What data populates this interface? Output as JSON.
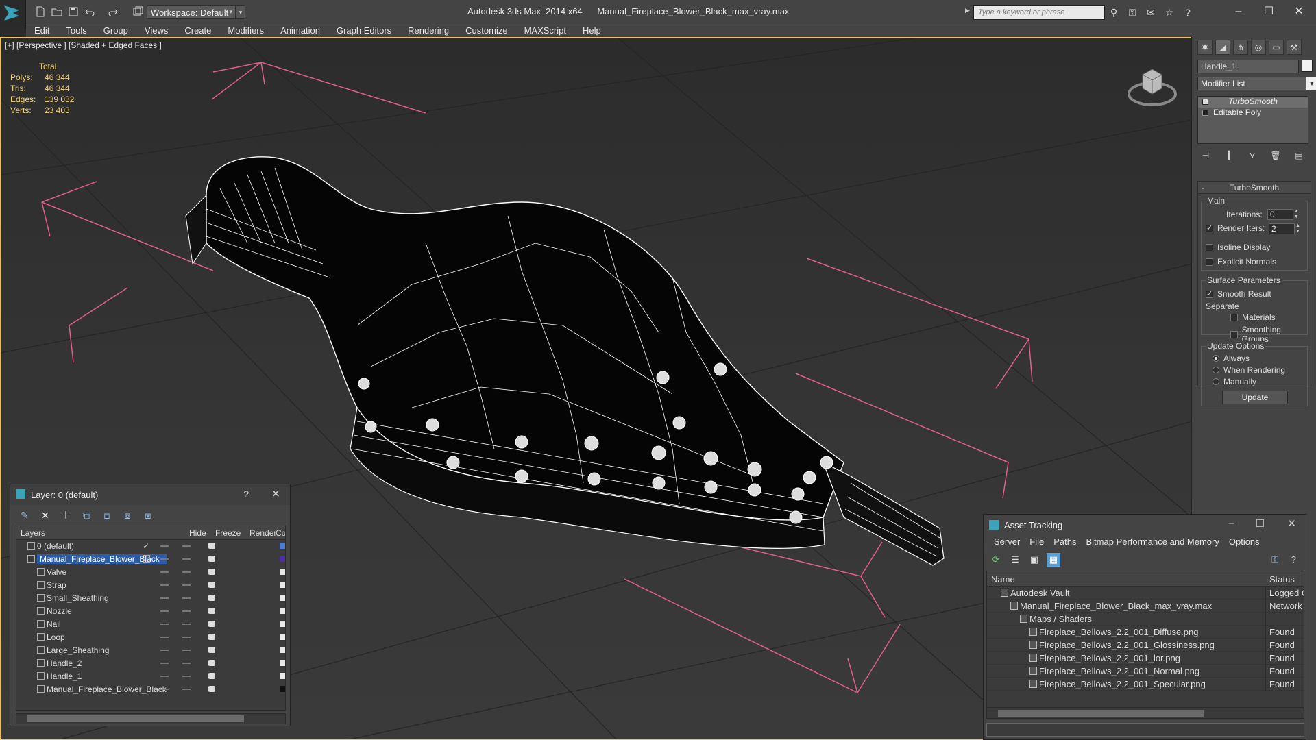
{
  "app": {
    "title": "Autodesk 3ds Max  2014 x64      Manual_Fireplace_Blower_Black_max_vray.max",
    "workspace": "Workspace: Default",
    "search_placeholder": "Type a keyword or phrase"
  },
  "menu": [
    "Edit",
    "Tools",
    "Group",
    "Views",
    "Create",
    "Modifiers",
    "Animation",
    "Graph Editors",
    "Rendering",
    "Customize",
    "MAXScript",
    "Help"
  ],
  "viewport": {
    "label": "[+] [Perspective ] [Shaded + Edged Faces ]",
    "stats": {
      "header": "Total",
      "rows": [
        {
          "k": "Polys:",
          "v": "46 344"
        },
        {
          "k": "Tris:",
          "v": "46 344"
        },
        {
          "k": "Edges:",
          "v": "139 032"
        },
        {
          "k": "Verts:",
          "v": "23 403"
        }
      ]
    }
  },
  "command_panel": {
    "object_name": "Handle_1",
    "modifier_list": "Modifier List",
    "stack": [
      {
        "label": "TurboSmooth",
        "selected": true
      },
      {
        "label": "Editable Poly",
        "selected": false
      }
    ],
    "rollout": {
      "title": "TurboSmooth",
      "collapse": "-",
      "main_label": "Main",
      "iterations_label": "Iterations:",
      "iterations_value": "0",
      "render_iters_label": "Render Iters:",
      "render_iters_value": "2",
      "isoline": "Isoline Display",
      "explicit_normals": "Explicit Normals",
      "surface_params": "Surface Parameters",
      "smooth_result": "Smooth Result",
      "separate": "Separate",
      "materials": "Materials",
      "smoothing_groups": "Smoothing Groups",
      "update_options": "Update Options",
      "always": "Always",
      "when_rendering": "When Rendering",
      "manually": "Manually",
      "update_button": "Update"
    }
  },
  "layer_window": {
    "title": "Layer: 0 (default)",
    "help": "?",
    "columns": {
      "layers": "Layers",
      "hide": "Hide",
      "freeze": "Freeze",
      "render": "Render",
      "color": "Col"
    },
    "rows": [
      {
        "name": "0 (default)",
        "level": 0,
        "color": "#4f7cd0",
        "check": true
      },
      {
        "name": "Manual_Fireplace_Blower_Black",
        "level": 0,
        "color": "#4b2ea8",
        "selected": true
      },
      {
        "name": "Valve",
        "level": 1,
        "color": "#e8e8e8"
      },
      {
        "name": "Strap",
        "level": 1,
        "color": "#e8e8e8"
      },
      {
        "name": "Small_Sheathing",
        "level": 1,
        "color": "#e8e8e8"
      },
      {
        "name": "Nozzle",
        "level": 1,
        "color": "#e8e8e8"
      },
      {
        "name": "Nail",
        "level": 1,
        "color": "#e8e8e8"
      },
      {
        "name": "Loop",
        "level": 1,
        "color": "#e8e8e8"
      },
      {
        "name": "Large_Sheathing",
        "level": 1,
        "color": "#e8e8e8"
      },
      {
        "name": "Handle_2",
        "level": 1,
        "color": "#e8e8e8"
      },
      {
        "name": "Handle_1",
        "level": 1,
        "color": "#e8e8e8"
      },
      {
        "name": "Manual_Fireplace_Blower_Black",
        "level": 1,
        "color": "#111111"
      }
    ]
  },
  "asset_window": {
    "title": "Asset Tracking",
    "menu": [
      "Server",
      "File",
      "Paths",
      "Bitmap Performance and Memory",
      "Options"
    ],
    "columns": {
      "name": "Name",
      "status": "Status"
    },
    "rows": [
      {
        "name": "Autodesk Vault",
        "level": 1,
        "status": "Logged O"
      },
      {
        "name": "Manual_Fireplace_Blower_Black_max_vray.max",
        "level": 2,
        "status": "Network P"
      },
      {
        "name": "Maps / Shaders",
        "level": 3,
        "status": ""
      },
      {
        "name": "Fireplace_Bellows_2.2_001_Diffuse.png",
        "level": 4,
        "status": "Found"
      },
      {
        "name": "Fireplace_Bellows_2.2_001_Glossiness.png",
        "level": 4,
        "status": "Found"
      },
      {
        "name": "Fireplace_Bellows_2.2_001_lor.png",
        "level": 4,
        "status": "Found"
      },
      {
        "name": "Fireplace_Bellows_2.2_001_Normal.png",
        "level": 4,
        "status": "Found"
      },
      {
        "name": "Fireplace_Bellows_2.2_001_Specular.png",
        "level": 4,
        "status": "Found"
      }
    ]
  },
  "colors": {
    "accent_selection": "#2a5caa",
    "viewport_border": "#f0c24a",
    "gizmo_pink": "#e0608a",
    "stats_text": "#f0d27a"
  }
}
